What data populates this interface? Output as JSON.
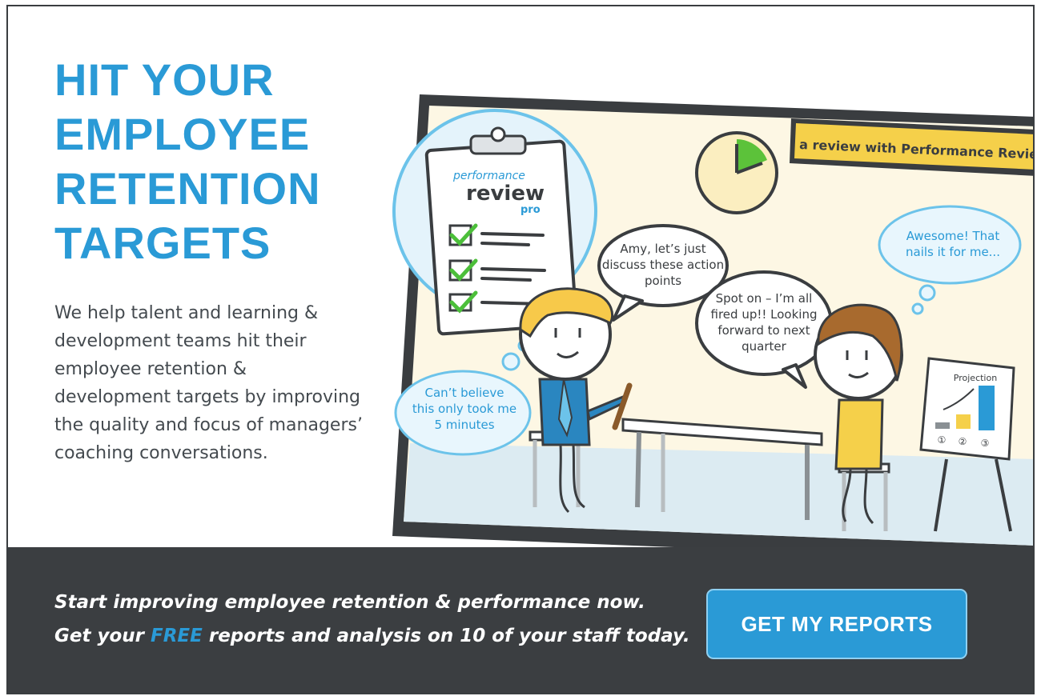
{
  "hero": {
    "headline": [
      "HIT YOUR",
      "EMPLOYEE",
      "RETENTION",
      "TARGETS"
    ],
    "description": "We help talent and learning & development teams hit their employee retention & development targets by improving the quality and focus of managers’ coaching conversations."
  },
  "illustration": {
    "banner": "a review with Performance Review Pro",
    "clipboard": {
      "script": "performance",
      "word": "review",
      "sub": "pro"
    },
    "speech_manager": [
      "Amy, let’s just",
      "discuss these action",
      "points"
    ],
    "speech_employee": [
      "Spot on – I’m all",
      "fired up!! Looking",
      "forward to next",
      "quarter"
    ],
    "thought_manager": [
      "Can’t believe",
      "this only took me",
      "5 minutes"
    ],
    "thought_employee": [
      "Awesome! That",
      "nails it for me..."
    ],
    "chart": {
      "title": "Projection",
      "labels": [
        "①",
        "②",
        "③"
      ]
    }
  },
  "cta": {
    "line1": "Start improving employee retention & performance now.",
    "line2_before": "Get your ",
    "line2_free": "FREE",
    "line2_after": " reports and analysis on 10 of your staff today.",
    "button_label": "GET MY REPORTS"
  },
  "colors": {
    "accent": "#2a9ad6",
    "band": "#3b3e41",
    "banner": "#f5d04a",
    "scene_bg": "#fdf7e4"
  }
}
